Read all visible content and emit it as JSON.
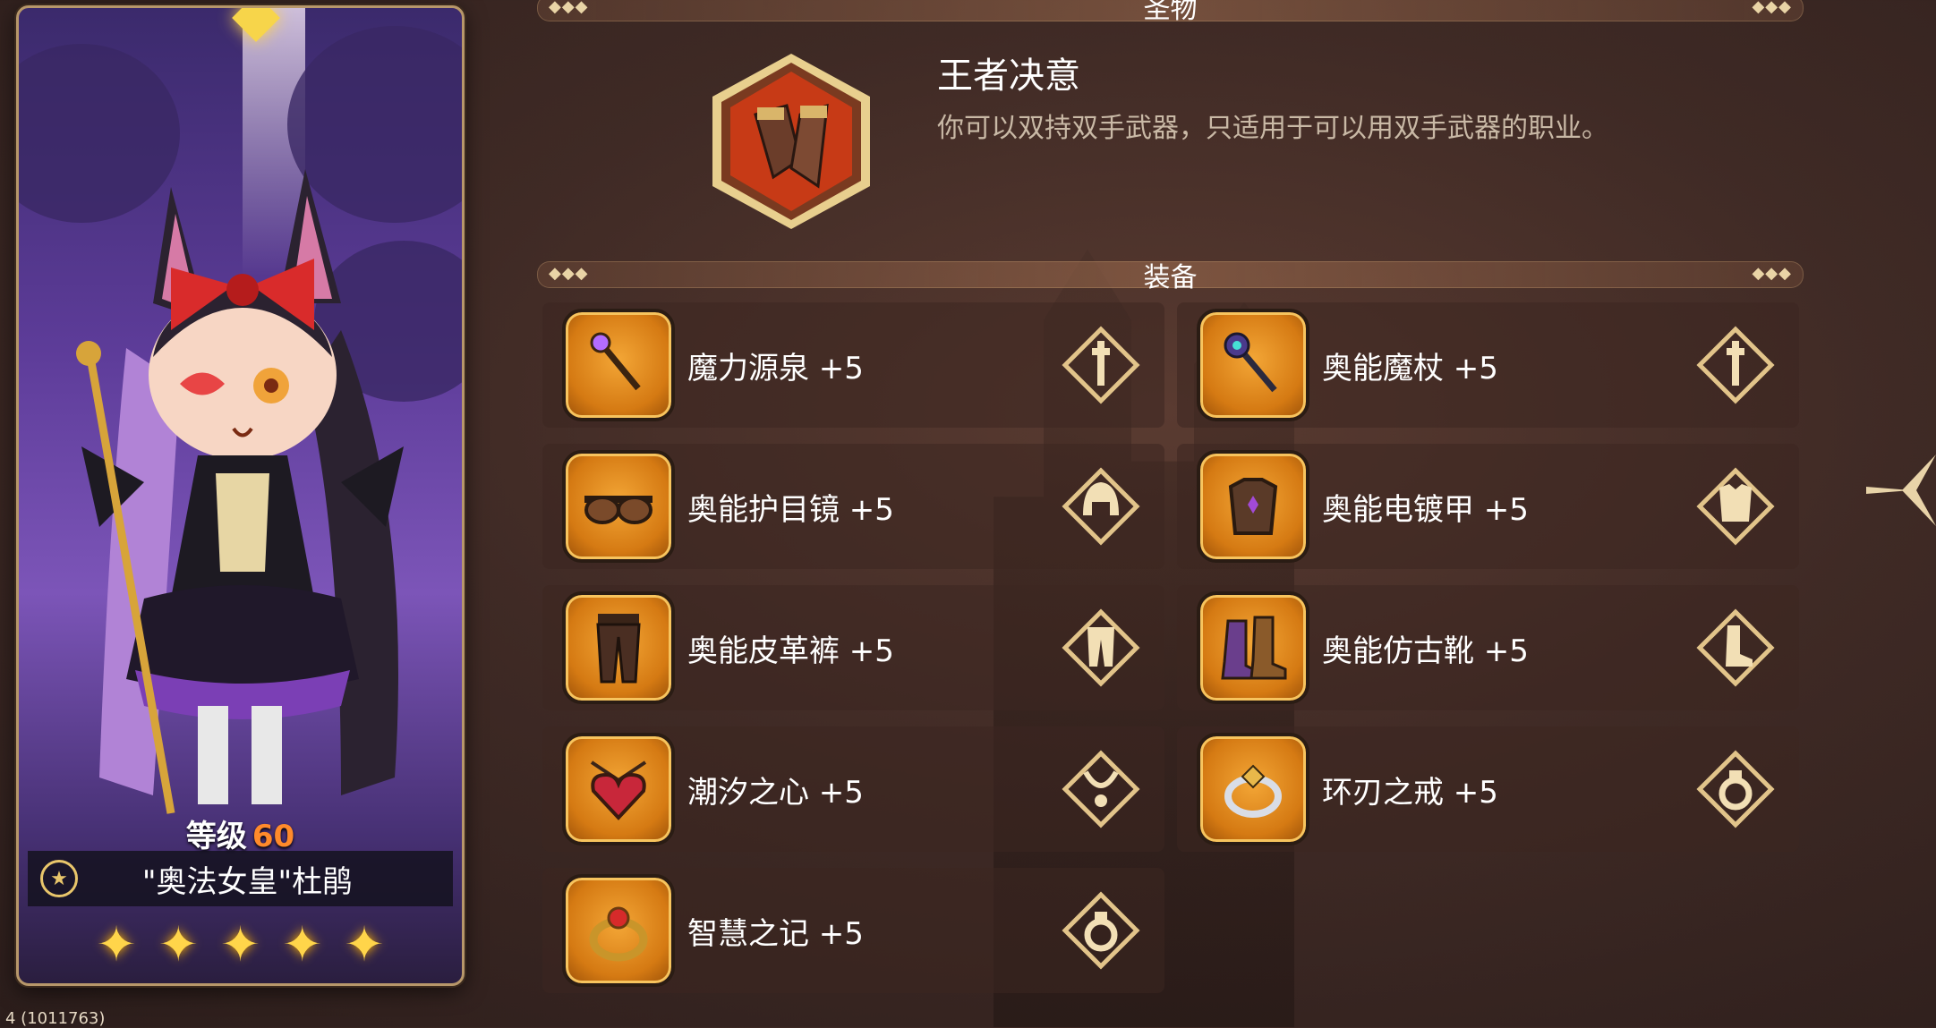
{
  "relic_section": {
    "title": "圣物",
    "relic": {
      "name": "王者决意",
      "description": "你可以双持双手武器，只适用于可以用双手武器的职业。",
      "icon": "gauntlets-icon"
    }
  },
  "equipment_section": {
    "title": "装备",
    "items": [
      {
        "name": "魔力源泉 +5",
        "icon": "scepter-icon",
        "slot_icon": "weapon-slot-icon"
      },
      {
        "name": "奥能魔杖 +5",
        "icon": "staff-icon",
        "slot_icon": "weapon-slot-icon"
      },
      {
        "name": "奥能护目镜 +5",
        "icon": "goggles-icon",
        "slot_icon": "helmet-slot-icon"
      },
      {
        "name": "奥能电镀甲 +5",
        "icon": "armor-icon",
        "slot_icon": "armor-slot-icon"
      },
      {
        "name": "奥能皮革裤 +5",
        "icon": "pants-icon",
        "slot_icon": "pants-slot-icon"
      },
      {
        "name": "奥能仿古靴 +5",
        "icon": "boots-icon",
        "slot_icon": "boots-slot-icon"
      },
      {
        "name": "潮汐之心 +5",
        "icon": "heart-amulet-icon",
        "slot_icon": "necklace-slot-icon"
      },
      {
        "name": "环刃之戒 +5",
        "icon": "silver-ring-icon",
        "slot_icon": "ring-slot-icon"
      },
      {
        "name": "智慧之记 +5",
        "icon": "gold-ring-icon",
        "slot_icon": "ring-slot-icon"
      }
    ]
  },
  "character": {
    "level_label": "等级",
    "level": "60",
    "name": "\"奥法女皇\"杜鹃",
    "stars": 5
  },
  "footer": {
    "coords": "4 (1011763)"
  },
  "colors": {
    "accent_gold": "#e9c66b",
    "level_orange": "#ff8a2b",
    "item_orange": "#d57a13"
  }
}
